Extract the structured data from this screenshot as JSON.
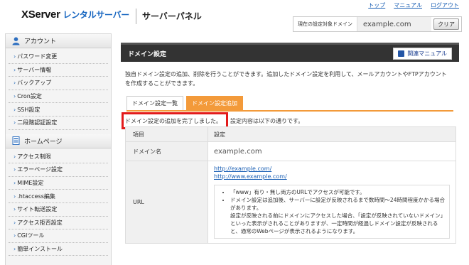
{
  "header": {
    "brand": "XServer",
    "brand_sub": "レンタルサーバー",
    "panel_title": "サーバーパネル",
    "links": [
      "トップ",
      "マニュアル",
      "ログアウト"
    ],
    "domain_label": "現在の設定対象ドメイン",
    "domain_value": "example.com",
    "clear_label": "クリア"
  },
  "sidebar": {
    "sections": [
      {
        "title": "アカウント",
        "icon": "user-icon",
        "items": [
          "パスワード変更",
          "サーバー情報",
          "バックアップ",
          "Cron設定",
          "SSH設定",
          "二段階認証設定"
        ]
      },
      {
        "title": "ホームページ",
        "icon": "page-icon",
        "items": [
          "アクセス制限",
          "エラーページ設定",
          "MIME設定",
          ".htaccess編集",
          "サイト転送設定",
          "アクセス拒否設定",
          "CGIツール",
          "簡単インストール"
        ]
      }
    ]
  },
  "main": {
    "title": "ドメイン設定",
    "manual_label": "関連マニュアル",
    "intro": "独自ドメイン設定の追加、削除を行うことができます。追加したドメイン設定を利用して、メールアカウントやFTPアカウントを作成することができます。",
    "tabs": [
      "ドメイン設定一覧",
      "ドメイン設定追加"
    ],
    "complete_message": "ドメイン設定の追加を完了しました。",
    "complete_rest": "設定内容は以下の通りです。",
    "table": {
      "header": [
        "項目",
        "設定"
      ],
      "domain_label": "ドメイン名",
      "domain_value": "example.com",
      "url_label": "URL",
      "url_links": [
        "http://example.com/",
        "http://www.example.com/"
      ],
      "notes": [
        "「www」有り・無し両方のURLでアクセスが可能です。",
        "ドメイン設定は追加後、サーバーに設定が反映されるまで数時間〜24時間程度かかる場合があります。",
        "設定が反映される前にドメインにアクセスした場合、「設定が反映されていないドメイン」といった表示がされることがありますが、一定時間が経過しドメイン設定が反映されると、通常のWebページが表示されるようになります。"
      ]
    }
  },
  "colors": {
    "accent": "#f39a3a",
    "title_bar": "#333333",
    "highlight": "#e31b1b",
    "link": "#1a5fb4"
  }
}
